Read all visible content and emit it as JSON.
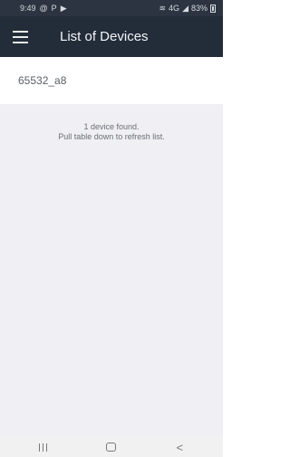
{
  "status_bar": {
    "time": "9:49",
    "left_icons": [
      "at-sign-icon",
      "parking-icon",
      "play-icon"
    ],
    "right_text": "83%",
    "right_icons": [
      "vibrate-icon",
      "lte-icon",
      "signal-icon",
      "battery-icon"
    ]
  },
  "app_bar": {
    "title": "List of Devices"
  },
  "devices": [
    {
      "name": "65532_a8"
    }
  ],
  "message": {
    "line1": "1 device found.",
    "line2": "Pull table down to refresh list."
  },
  "nav_bar": {
    "buttons": [
      "recents",
      "home",
      "back"
    ]
  },
  "colors": {
    "app_bar_bg": "#232d3a",
    "status_bar_bg": "#2b3440",
    "list_bg": "#efeff4"
  }
}
